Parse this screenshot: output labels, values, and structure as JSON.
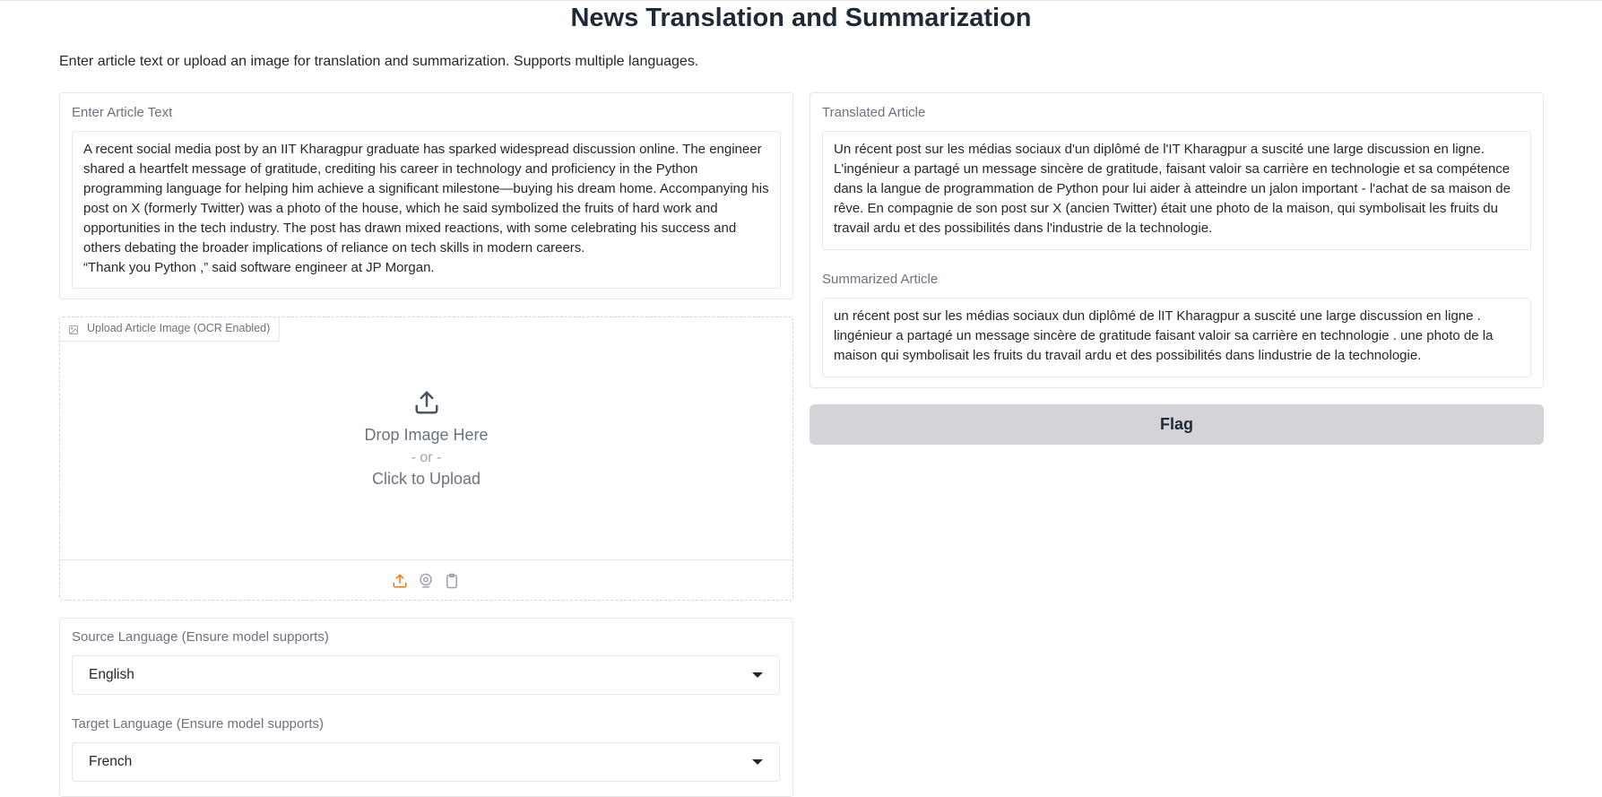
{
  "header": {
    "title": "News Translation and Summarization",
    "description": "Enter article text or upload an image for translation and summarization. Supports multiple languages."
  },
  "input_text": {
    "label": "Enter Article Text",
    "value": "A recent social media post by an IIT Kharagpur graduate has sparked widespread discussion online. The engineer shared a heartfelt message of gratitude, crediting his career in technology and proficiency in the Python programming language for helping him achieve a significant milestone—buying his dream home. Accompanying his post on X (formerly Twitter) was a photo of the house, which he said symbolized the fruits of hard work and opportunities in the tech industry. The post has drawn mixed reactions, with some celebrating his success and others debating the broader implications of reliance on tech skills in modern careers.\n“Thank you Python ,” said software engineer at JP Morgan."
  },
  "image_upload": {
    "label": "Upload Article Image (OCR Enabled)",
    "drop_text": "Drop Image Here",
    "or_text": "- or -",
    "click_text": "Click to Upload",
    "sources": [
      "upload-icon",
      "webcam-icon",
      "clipboard-icon"
    ],
    "active_source_color": "#f97316"
  },
  "source_language": {
    "label": "Source Language (Ensure model supports)",
    "value": "English"
  },
  "target_language": {
    "label": "Target Language (Ensure model supports)",
    "value": "French"
  },
  "translated": {
    "label": "Translated Article",
    "value": "Un récent post sur les médias sociaux d'un diplômé de l'IT Kharagpur a suscité une large discussion en ligne. L'ingénieur a partagé un message sincère de gratitude, faisant valoir sa carrière en technologie et sa compétence dans la langue de programmation de Python pour lui aider à atteindre un jalon important - l'achat de sa maison de rêve. En compagnie de son post sur X (ancien Twitter) était une photo de la maison, qui symbolisait les fruits du travail ardu et des possibilités dans l'industrie de la technologie."
  },
  "summarized": {
    "label": "Summarized Article",
    "value": "un récent post sur les médias sociaux dun diplômé de lIT Kharagpur a suscité une large discussion en ligne . lingénieur a partagé un message sincère de gratitude faisant valoir sa carrière en technologie . une photo de la maison qui symbolisait les fruits du travail ardu et des possibilités dans lindustrie de la technologie."
  },
  "actions": {
    "flag_label": "Flag"
  },
  "colors": {
    "accent": "#f97316",
    "button_bg": "#d4d4d8",
    "border": "#e5e7eb"
  }
}
